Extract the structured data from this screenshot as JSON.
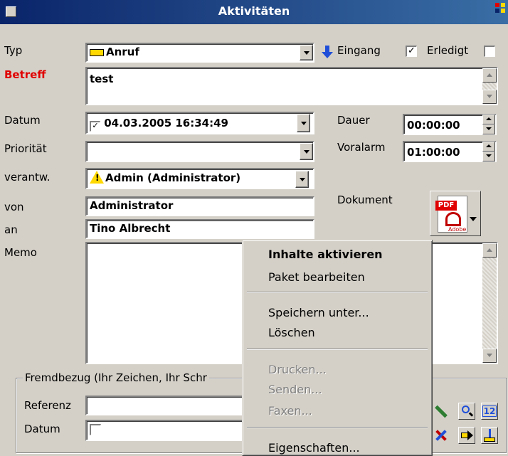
{
  "window": {
    "title": "Aktivitäten"
  },
  "form": {
    "typ_label": "Typ",
    "typ_value": "Anruf",
    "eingang_label": "Eingang",
    "eingang_checked": "✓",
    "erledigt_label": "Erledigt",
    "betreff_label": "Betreff",
    "betreff_value": "test",
    "datum_label": "Datum",
    "datum_value": "04.03.2005 16:34:49",
    "datum_checked": "✓",
    "dauer_label": "Dauer",
    "dauer_value": "00:00:00",
    "prioritaet_label": "Priorität",
    "prioritaet_value": "",
    "voralarm_label": "Voralarm",
    "voralarm_value": "01:00:00",
    "verantw_label": "verantw.",
    "verantw_value": "Admin (Administrator)",
    "dokument_label": "Dokument",
    "von_label": "von",
    "von_value": "Administrator",
    "an_label": "an",
    "an_value": "Tino Albrecht",
    "memo_label": "Memo",
    "fremdbezug_label": "Fremdbezug (Ihr Zeichen, Ihr Schr",
    "referenz_label": "Referenz",
    "referenz_value": "",
    "datum2_label": "Datum"
  },
  "document": {
    "icon_text": "PDF",
    "icon_sub": "Adobe"
  },
  "toolbar": {
    "calendar_text": "12"
  },
  "context_menu": {
    "items": [
      {
        "label": "Inhalte aktivieren",
        "bold": true,
        "disabled": false
      },
      {
        "label": "Paket bearbeiten",
        "bold": false,
        "disabled": false
      },
      {
        "label": "Speichern unter...",
        "bold": false,
        "disabled": false
      },
      {
        "label": "Löschen",
        "bold": false,
        "disabled": false
      },
      {
        "label": "Drucken...",
        "bold": false,
        "disabled": true
      },
      {
        "label": "Senden...",
        "bold": false,
        "disabled": true
      },
      {
        "label": "Faxen...",
        "bold": false,
        "disabled": true
      },
      {
        "label": "Eigenschaften...",
        "bold": false,
        "disabled": false
      }
    ]
  },
  "colors": {
    "title_start": "#0a246a",
    "title_end": "#3a6ea5",
    "betreff_label": "#e00000",
    "face": "#d4d0c8"
  }
}
